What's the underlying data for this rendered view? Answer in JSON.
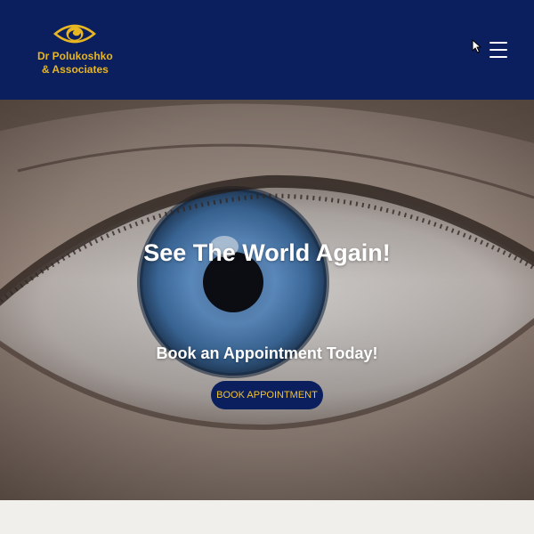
{
  "header": {
    "brand": {
      "line1": "Dr Polukoshko",
      "line2": "& Associates",
      "logo_icon": "eye-logo-icon"
    },
    "menu_icon": "hamburger-menu-icon",
    "pointer_icon": "mouse-pointer-icon"
  },
  "hero": {
    "title": "See The World Again!",
    "subtitle": "Book an Appointment Today!",
    "cta_label": "BOOK APPOINTMENT",
    "background": "close-up photo of a blue eye"
  },
  "colors": {
    "header_bg": "#0b1f5e",
    "brand_gold": "#e8b623",
    "button_bg": "#0b1f5e",
    "button_text": "#f1c232",
    "page_bg": "#f1efec"
  }
}
